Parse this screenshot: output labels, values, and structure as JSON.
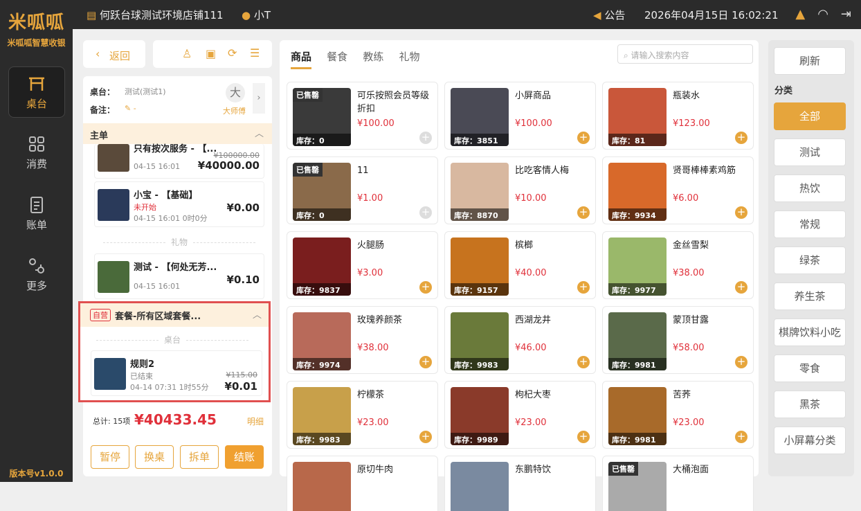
{
  "brand": {
    "logo": "米呱呱",
    "subtitle": "米呱呱智慧收银",
    "version": "版本号v1.0.0"
  },
  "nav": [
    {
      "label": "桌台",
      "icon": "table-icon"
    },
    {
      "label": "消费",
      "icon": "grid-icon"
    },
    {
      "label": "账单",
      "icon": "bill-icon"
    },
    {
      "label": "更多",
      "icon": "more-icon"
    }
  ],
  "topbar": {
    "store": "何跃台球测试环境店铺111",
    "user": "小T",
    "notice": "公告",
    "datetime": "2026年04月15日  16:02:21"
  },
  "left": {
    "back": "返回",
    "table_label": "桌台：",
    "table_value": "测试(测试1)",
    "note_label": "备注：",
    "note_value": "-",
    "master_avatar": "大",
    "master_name": "大师傅",
    "main_order": "主单",
    "orders": [
      {
        "title": "只有按次服务 - 【...",
        "orig": "¥100000.00",
        "date": "04-15 16:01",
        "price": "¥40000.00",
        "status": ""
      },
      {
        "title": "小宝 - 【基础】",
        "status": "未开始",
        "date": "04-15 16:01 0时0分",
        "price": "¥0.00",
        "orig": ""
      }
    ],
    "gift_sep": "礼物",
    "gift": {
      "title": "测试 - 【何处无芳...",
      "date": "04-15 16:01",
      "price": "¥0.10"
    },
    "package": {
      "tag": "自营",
      "title": "套餐-所有区域套餐...",
      "sep": "桌台",
      "item_title": "规则2",
      "item_status": "已结束",
      "item_orig": "¥115.00",
      "item_date": "04-14 07:31 1时55分",
      "item_price": "¥0.01"
    },
    "total_label": "总计: 15项",
    "total": "¥40433.45",
    "detail": "明细",
    "actions": [
      "暂停",
      "换桌",
      "拆单",
      "结账"
    ]
  },
  "tabs": [
    "商品",
    "餐食",
    "教练",
    "礼物"
  ],
  "search_placeholder": "请输入搜索内容",
  "products": [
    {
      "name": "可乐按照会员等级折扣",
      "price": "¥100.00",
      "stock": "库存：0",
      "sold": "已售罄",
      "color": "#3a3a3a"
    },
    {
      "name": "小屏商品",
      "price": "¥100.00",
      "stock": "库存：3851",
      "sold": "",
      "color": "#4a4a55"
    },
    {
      "name": "瓶装水",
      "price": "¥123.00",
      "stock": "库存：81",
      "sold": "",
      "color": "#c9573a"
    },
    {
      "name": "11",
      "price": "¥1.00",
      "stock": "库存：0",
      "sold": "已售罄",
      "color": "#8a6a4a"
    },
    {
      "name": "比吃客情人梅",
      "price": "¥10.00",
      "stock": "库存：8870",
      "sold": "",
      "color": "#d8b8a0"
    },
    {
      "name": "贤哥棒棒素鸡筋",
      "price": "¥6.00",
      "stock": "库存：9934",
      "sold": "",
      "color": "#d8692a"
    },
    {
      "name": "火腿肠",
      "price": "¥3.00",
      "stock": "库存：9837",
      "sold": "",
      "color": "#7a1e1e"
    },
    {
      "name": "槟榔",
      "price": "¥40.00",
      "stock": "库存：9157",
      "sold": "",
      "color": "#c7731e"
    },
    {
      "name": "金丝雪梨",
      "price": "¥38.00",
      "stock": "库存：9977",
      "sold": "",
      "color": "#9ab86a"
    },
    {
      "name": "玫瑰养颜茶",
      "price": "¥38.00",
      "stock": "库存：9974",
      "sold": "",
      "color": "#b86a5a"
    },
    {
      "name": "西湖龙井",
      "price": "¥46.00",
      "stock": "库存：9983",
      "sold": "",
      "color": "#6a7a3a"
    },
    {
      "name": "蒙顶甘露",
      "price": "¥58.00",
      "stock": "库存：9981",
      "sold": "",
      "color": "#5a6a4a"
    },
    {
      "name": "柠檬茶",
      "price": "¥23.00",
      "stock": "库存：9983",
      "sold": "",
      "color": "#c8a04a"
    },
    {
      "name": "枸杞大枣",
      "price": "¥23.00",
      "stock": "库存：9989",
      "sold": "",
      "color": "#8a3a2a"
    },
    {
      "name": "苦荞",
      "price": "¥23.00",
      "stock": "库存：9981",
      "sold": "",
      "color": "#a86a2a"
    },
    {
      "name": "原切牛肉",
      "price": "",
      "stock": "",
      "sold": "",
      "color": "#b8684a"
    },
    {
      "name": "东鹏特饮",
      "price": "",
      "stock": "",
      "sold": "",
      "color": "#7a8aa0"
    },
    {
      "name": "大桶泡面",
      "price": "",
      "stock": "",
      "sold": "已售罄",
      "color": "#aaaaaa"
    }
  ],
  "category_title": "分类",
  "refresh": "刷新",
  "categories": [
    "全部",
    "测试",
    "热饮",
    "常规",
    "绿茶",
    "养生茶",
    "棋牌饮料小吃",
    "零食",
    "黑茶",
    "小屏幕分类"
  ]
}
